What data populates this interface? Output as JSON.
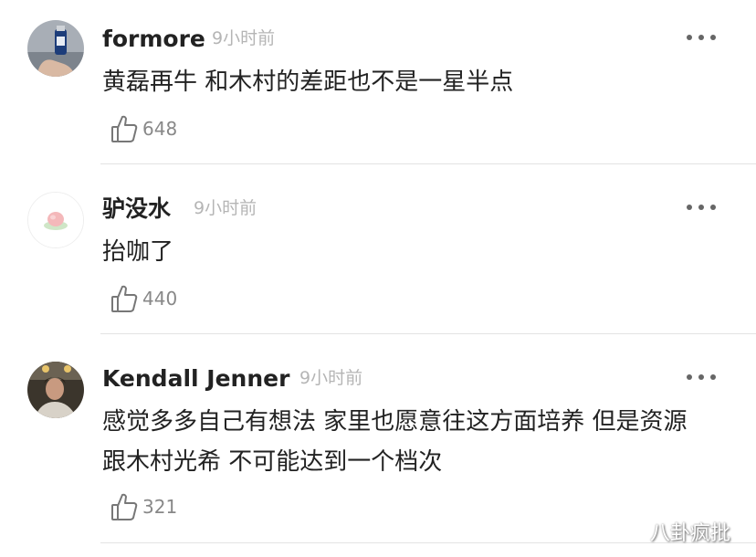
{
  "comments": [
    {
      "username": "formore",
      "time": "9小时前",
      "text": "黄磊再牛 和木村的差距也不是一星半点",
      "likes": "648"
    },
    {
      "username": "驴没水",
      "time": "9小时前",
      "text": "抬咖了",
      "likes": "440"
    },
    {
      "username": "Kendall Jenner",
      "time": "9小时前",
      "text": "感觉多多自己有想法 家里也愿意往这方面培养 但是资源跟木村光希 不可能达到一个档次",
      "likes": "321"
    }
  ],
  "icons": {
    "like": "thumbs-up-icon",
    "more": "more-horizontal-icon"
  },
  "colors": {
    "text": "#222222",
    "muted": "#b5b5b5",
    "count": "#888888",
    "divider": "#e3e3e3"
  },
  "watermark": "八卦疯批"
}
